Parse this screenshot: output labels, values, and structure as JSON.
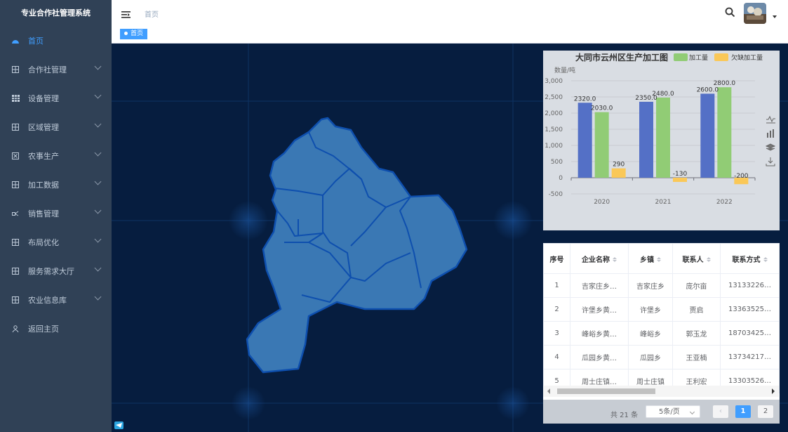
{
  "app": {
    "title": "专业合作社管理系统"
  },
  "sidebar": {
    "items": [
      {
        "label": "首页",
        "icon": "dashboard-icon",
        "active": true,
        "has_children": false
      },
      {
        "label": "合作社管理",
        "icon": "grid-icon",
        "has_children": true
      },
      {
        "label": "设备管理",
        "icon": "table-icon",
        "has_children": true
      },
      {
        "label": "区域管理",
        "icon": "grid-icon",
        "has_children": true
      },
      {
        "label": "农事生产",
        "icon": "box-icon",
        "has_children": true
      },
      {
        "label": "加工数据",
        "icon": "grid-icon",
        "has_children": true
      },
      {
        "label": "销售管理",
        "icon": "flow-icon",
        "has_children": true
      },
      {
        "label": "布局优化",
        "icon": "grid-icon",
        "has_children": true
      },
      {
        "label": "服务需求大厅",
        "icon": "grid-icon",
        "has_children": true
      },
      {
        "label": "农业信息库",
        "icon": "grid-icon",
        "has_children": true
      },
      {
        "label": "返回主页",
        "icon": "user-icon",
        "has_children": false
      }
    ]
  },
  "navbar": {
    "breadcrumb": "首页"
  },
  "tags": {
    "home": "首页"
  },
  "colors": {
    "accent": "#409eff",
    "sidebar_bg": "#304156",
    "map_fill": "#3a78b4",
    "map_border": "#0e4fae",
    "bar_blue": "#5470c6",
    "bar_green": "#91cc75",
    "bar_yellow": "#fac858"
  },
  "chart_data": {
    "type": "bar",
    "title": "大同市云州区生产加工图",
    "ylabel": "数量/吨",
    "categories": [
      "2020",
      "2021",
      "2022"
    ],
    "series": [
      {
        "name": "",
        "values": [
          2320.0,
          2350.0,
          2600.0
        ],
        "color": "#5470c6"
      },
      {
        "name": "加工量",
        "values": [
          2030.0,
          2480.0,
          2800.0
        ],
        "color": "#91cc75"
      },
      {
        "name": "欠缺加工量",
        "values": [
          290,
          -130,
          -200
        ],
        "color": "#fac858"
      }
    ],
    "labels": [
      [
        "2320.0",
        "2350.0",
        "2600.0"
      ],
      [
        "2030.0",
        "2480.0",
        "2800.0"
      ],
      [
        "290",
        "-130",
        "-200"
      ]
    ],
    "yticks": [
      -500,
      0,
      500,
      1000,
      1500,
      2000,
      2500,
      3000
    ],
    "ytick_labels": [
      "-500",
      "0",
      "500",
      "1,000",
      "1,500",
      "2,000",
      "2,500",
      "3,000"
    ],
    "ylim": [
      -500,
      3000
    ],
    "legend": "top-right",
    "toolbox": [
      "line-chart-icon",
      "bar-chart-icon",
      "stack-icon",
      "download-icon"
    ]
  },
  "table": {
    "columns": [
      "序号",
      "企业名称",
      "乡镇",
      "联系人",
      "联系方式"
    ],
    "rows": [
      [
        "1",
        "吉家庄乡…",
        "吉家庄乡",
        "庞尔亩",
        "13133226…"
      ],
      [
        "2",
        "许堡乡黄…",
        "许堡乡",
        "贾启",
        "13363525…"
      ],
      [
        "3",
        "峰峪乡黄…",
        "峰峪乡",
        "郭玉龙",
        "18703425…"
      ],
      [
        "4",
        "瓜园乡黄…",
        "瓜园乡",
        "王亚楠",
        "13734217…"
      ],
      [
        "5",
        "周士庄镇…",
        "周士庄镇",
        "王利宏",
        "13303526…"
      ]
    ]
  },
  "pagination": {
    "total": "共 21 条",
    "page_size": "5条/页",
    "pages": [
      "1",
      "2"
    ],
    "current": "1"
  }
}
